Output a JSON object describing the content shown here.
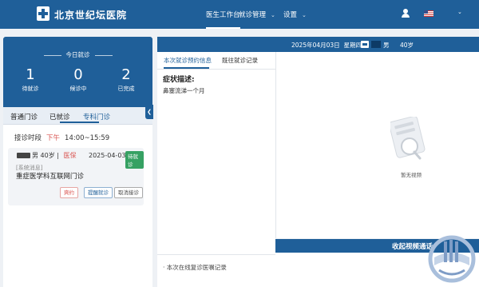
{
  "header": {
    "brand": "北京世纪坛医院",
    "nav": [
      {
        "label": "医生工作台",
        "has_caret": false
      },
      {
        "label": "就诊管理",
        "has_caret": true
      },
      {
        "label": "设置",
        "has_caret": true
      }
    ],
    "icons": [
      "user-icon",
      "us-flag-icon",
      "chevron-down-icon"
    ]
  },
  "stats": {
    "title": "今日就诊",
    "items": [
      {
        "value": "1",
        "label": "待就诊"
      },
      {
        "value": "0",
        "label": "候诊中"
      },
      {
        "value": "2",
        "label": "已完成"
      }
    ]
  },
  "tabs": {
    "items": [
      "普通门诊",
      "已就诊",
      "专科门诊"
    ],
    "active": "专科门诊"
  },
  "schedule": {
    "label": "接诊时段",
    "period": "下午",
    "time": "14:00~15:59"
  },
  "appointment": {
    "patient_info": "男 40岁",
    "insurance": "医保",
    "date": "2025-04-03",
    "status": "待就诊",
    "system_message": "[系统消息]",
    "clinic": "重症医学科互联网门诊",
    "buttons": [
      "爽约",
      "提醒就诊",
      "取消接诊"
    ]
  },
  "patient_bar": {
    "date": "2025年04月03日",
    "weekday": "星期四",
    "gender": "男",
    "age": "40岁"
  },
  "middle": {
    "tabs": [
      "本次就诊预约信息",
      "既往就诊记录"
    ],
    "active_tab": "本次就诊预约信息",
    "symptom_title": "症状描述:",
    "symptom_text": "鼻塞流涕一个月",
    "record_title": "· 本次在线复诊医嘱记录"
  },
  "video": {
    "empty_text": "暂无视频",
    "collapse_button": "收起视频通话"
  },
  "colors": {
    "primary": "#1f5f99",
    "danger": "#d9534f",
    "success": "#36a163"
  }
}
